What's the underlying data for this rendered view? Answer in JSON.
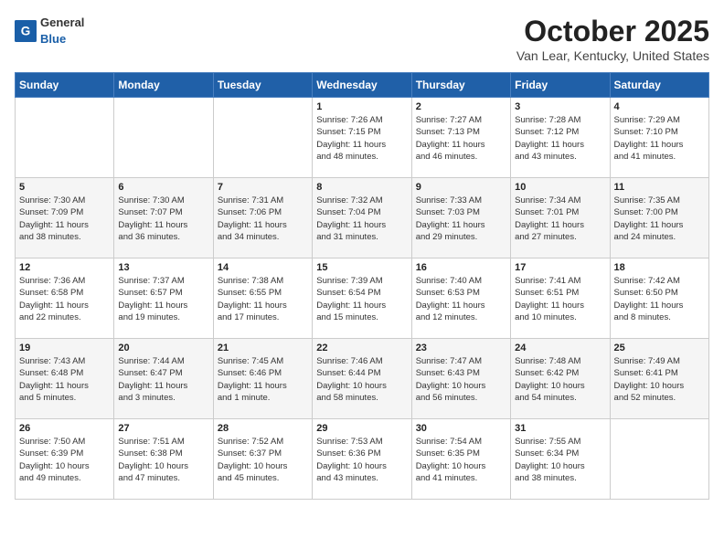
{
  "header": {
    "logo_general": "General",
    "logo_blue": "Blue",
    "title": "October 2025",
    "subtitle": "Van Lear, Kentucky, United States"
  },
  "days_of_week": [
    "Sunday",
    "Monday",
    "Tuesday",
    "Wednesday",
    "Thursday",
    "Friday",
    "Saturday"
  ],
  "weeks": [
    [
      {
        "day": "",
        "info": ""
      },
      {
        "day": "",
        "info": ""
      },
      {
        "day": "",
        "info": ""
      },
      {
        "day": "1",
        "info": "Sunrise: 7:26 AM\nSunset: 7:15 PM\nDaylight: 11 hours\nand 48 minutes."
      },
      {
        "day": "2",
        "info": "Sunrise: 7:27 AM\nSunset: 7:13 PM\nDaylight: 11 hours\nand 46 minutes."
      },
      {
        "day": "3",
        "info": "Sunrise: 7:28 AM\nSunset: 7:12 PM\nDaylight: 11 hours\nand 43 minutes."
      },
      {
        "day": "4",
        "info": "Sunrise: 7:29 AM\nSunset: 7:10 PM\nDaylight: 11 hours\nand 41 minutes."
      }
    ],
    [
      {
        "day": "5",
        "info": "Sunrise: 7:30 AM\nSunset: 7:09 PM\nDaylight: 11 hours\nand 38 minutes."
      },
      {
        "day": "6",
        "info": "Sunrise: 7:30 AM\nSunset: 7:07 PM\nDaylight: 11 hours\nand 36 minutes."
      },
      {
        "day": "7",
        "info": "Sunrise: 7:31 AM\nSunset: 7:06 PM\nDaylight: 11 hours\nand 34 minutes."
      },
      {
        "day": "8",
        "info": "Sunrise: 7:32 AM\nSunset: 7:04 PM\nDaylight: 11 hours\nand 31 minutes."
      },
      {
        "day": "9",
        "info": "Sunrise: 7:33 AM\nSunset: 7:03 PM\nDaylight: 11 hours\nand 29 minutes."
      },
      {
        "day": "10",
        "info": "Sunrise: 7:34 AM\nSunset: 7:01 PM\nDaylight: 11 hours\nand 27 minutes."
      },
      {
        "day": "11",
        "info": "Sunrise: 7:35 AM\nSunset: 7:00 PM\nDaylight: 11 hours\nand 24 minutes."
      }
    ],
    [
      {
        "day": "12",
        "info": "Sunrise: 7:36 AM\nSunset: 6:58 PM\nDaylight: 11 hours\nand 22 minutes."
      },
      {
        "day": "13",
        "info": "Sunrise: 7:37 AM\nSunset: 6:57 PM\nDaylight: 11 hours\nand 19 minutes."
      },
      {
        "day": "14",
        "info": "Sunrise: 7:38 AM\nSunset: 6:55 PM\nDaylight: 11 hours\nand 17 minutes."
      },
      {
        "day": "15",
        "info": "Sunrise: 7:39 AM\nSunset: 6:54 PM\nDaylight: 11 hours\nand 15 minutes."
      },
      {
        "day": "16",
        "info": "Sunrise: 7:40 AM\nSunset: 6:53 PM\nDaylight: 11 hours\nand 12 minutes."
      },
      {
        "day": "17",
        "info": "Sunrise: 7:41 AM\nSunset: 6:51 PM\nDaylight: 11 hours\nand 10 minutes."
      },
      {
        "day": "18",
        "info": "Sunrise: 7:42 AM\nSunset: 6:50 PM\nDaylight: 11 hours\nand 8 minutes."
      }
    ],
    [
      {
        "day": "19",
        "info": "Sunrise: 7:43 AM\nSunset: 6:48 PM\nDaylight: 11 hours\nand 5 minutes."
      },
      {
        "day": "20",
        "info": "Sunrise: 7:44 AM\nSunset: 6:47 PM\nDaylight: 11 hours\nand 3 minutes."
      },
      {
        "day": "21",
        "info": "Sunrise: 7:45 AM\nSunset: 6:46 PM\nDaylight: 11 hours\nand 1 minute."
      },
      {
        "day": "22",
        "info": "Sunrise: 7:46 AM\nSunset: 6:44 PM\nDaylight: 10 hours\nand 58 minutes."
      },
      {
        "day": "23",
        "info": "Sunrise: 7:47 AM\nSunset: 6:43 PM\nDaylight: 10 hours\nand 56 minutes."
      },
      {
        "day": "24",
        "info": "Sunrise: 7:48 AM\nSunset: 6:42 PM\nDaylight: 10 hours\nand 54 minutes."
      },
      {
        "day": "25",
        "info": "Sunrise: 7:49 AM\nSunset: 6:41 PM\nDaylight: 10 hours\nand 52 minutes."
      }
    ],
    [
      {
        "day": "26",
        "info": "Sunrise: 7:50 AM\nSunset: 6:39 PM\nDaylight: 10 hours\nand 49 minutes."
      },
      {
        "day": "27",
        "info": "Sunrise: 7:51 AM\nSunset: 6:38 PM\nDaylight: 10 hours\nand 47 minutes."
      },
      {
        "day": "28",
        "info": "Sunrise: 7:52 AM\nSunset: 6:37 PM\nDaylight: 10 hours\nand 45 minutes."
      },
      {
        "day": "29",
        "info": "Sunrise: 7:53 AM\nSunset: 6:36 PM\nDaylight: 10 hours\nand 43 minutes."
      },
      {
        "day": "30",
        "info": "Sunrise: 7:54 AM\nSunset: 6:35 PM\nDaylight: 10 hours\nand 41 minutes."
      },
      {
        "day": "31",
        "info": "Sunrise: 7:55 AM\nSunset: 6:34 PM\nDaylight: 10 hours\nand 38 minutes."
      },
      {
        "day": "",
        "info": ""
      }
    ]
  ]
}
